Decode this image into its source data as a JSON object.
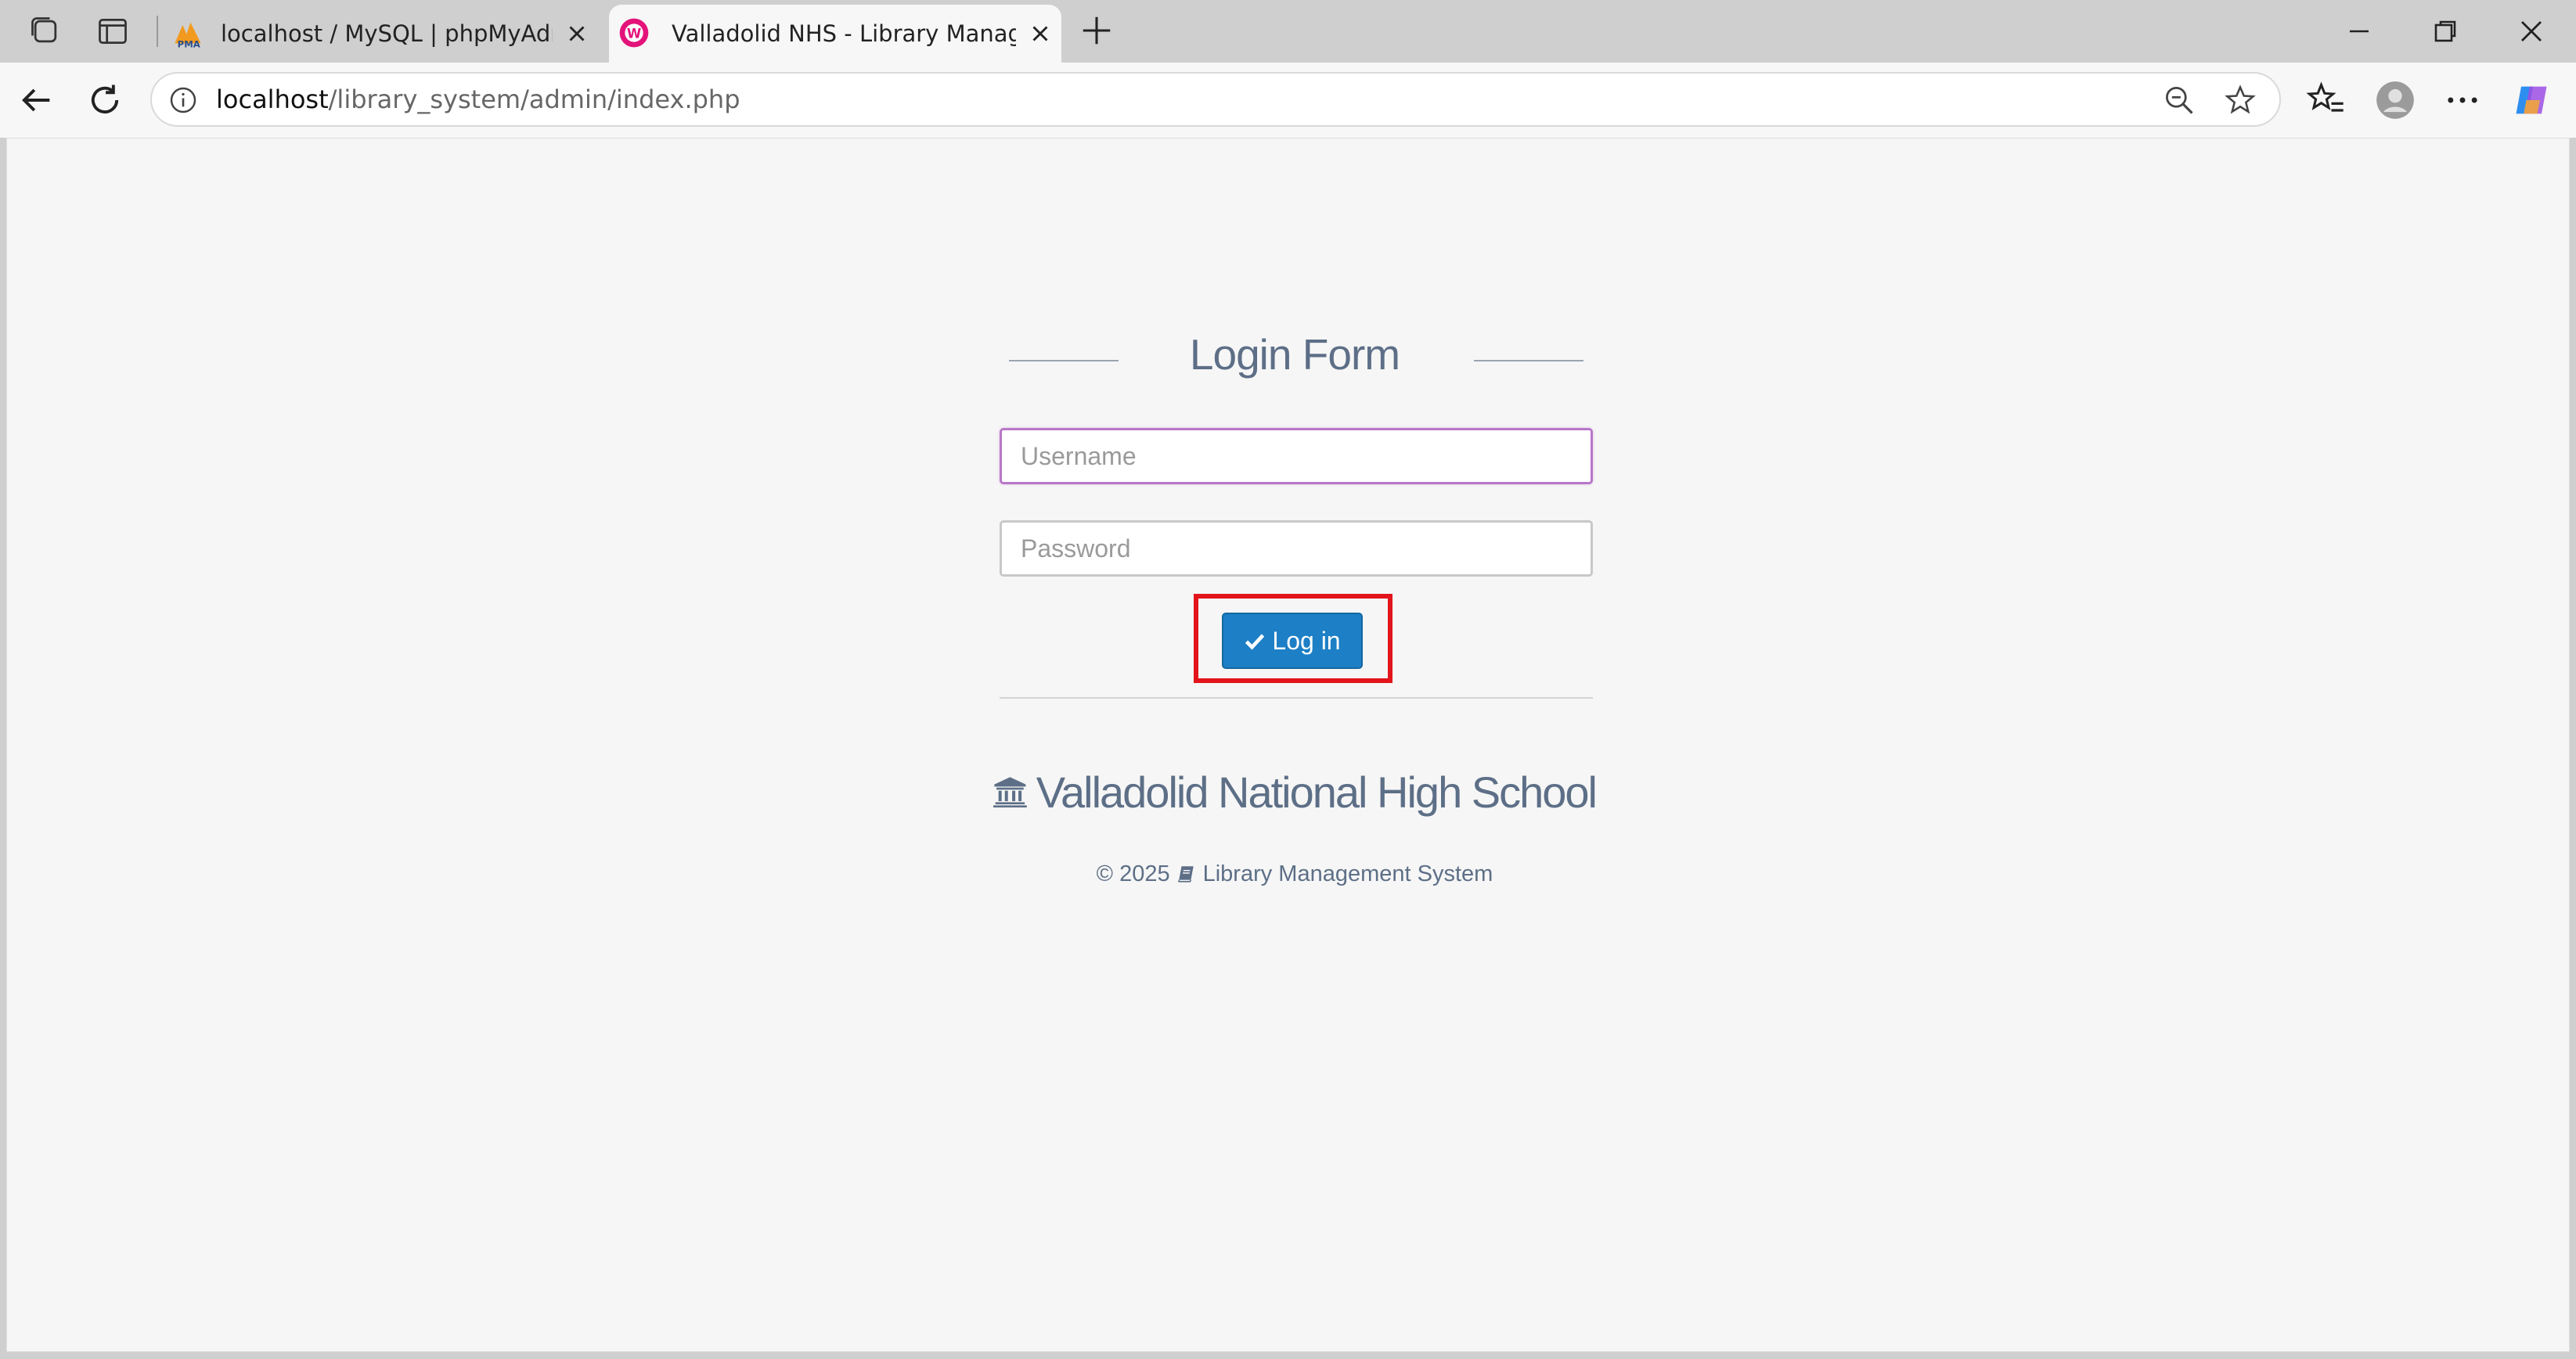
{
  "browser": {
    "tabs": [
      {
        "title": "localhost / MySQL | phpMyAdmin",
        "favicon": "phpmyadmin-icon",
        "active": false
      },
      {
        "title": "Valladolid NHS - Library Management",
        "favicon": "wamp-icon",
        "active": true
      }
    ],
    "address": {
      "host": "localhost",
      "path": "/library_system/admin/index.php"
    }
  },
  "login": {
    "title": "Login Form",
    "username_placeholder": "Username",
    "password_placeholder": "Password",
    "login_label": "Log in",
    "school_name": "Valladolid National High School",
    "footer_copyright": "© 2025",
    "footer_system": "Library Management System"
  },
  "colors": {
    "button": "#1d7fc6",
    "highlight": "#e3141b",
    "heading": "#5d6f87",
    "focus_border": "#b877c8"
  }
}
